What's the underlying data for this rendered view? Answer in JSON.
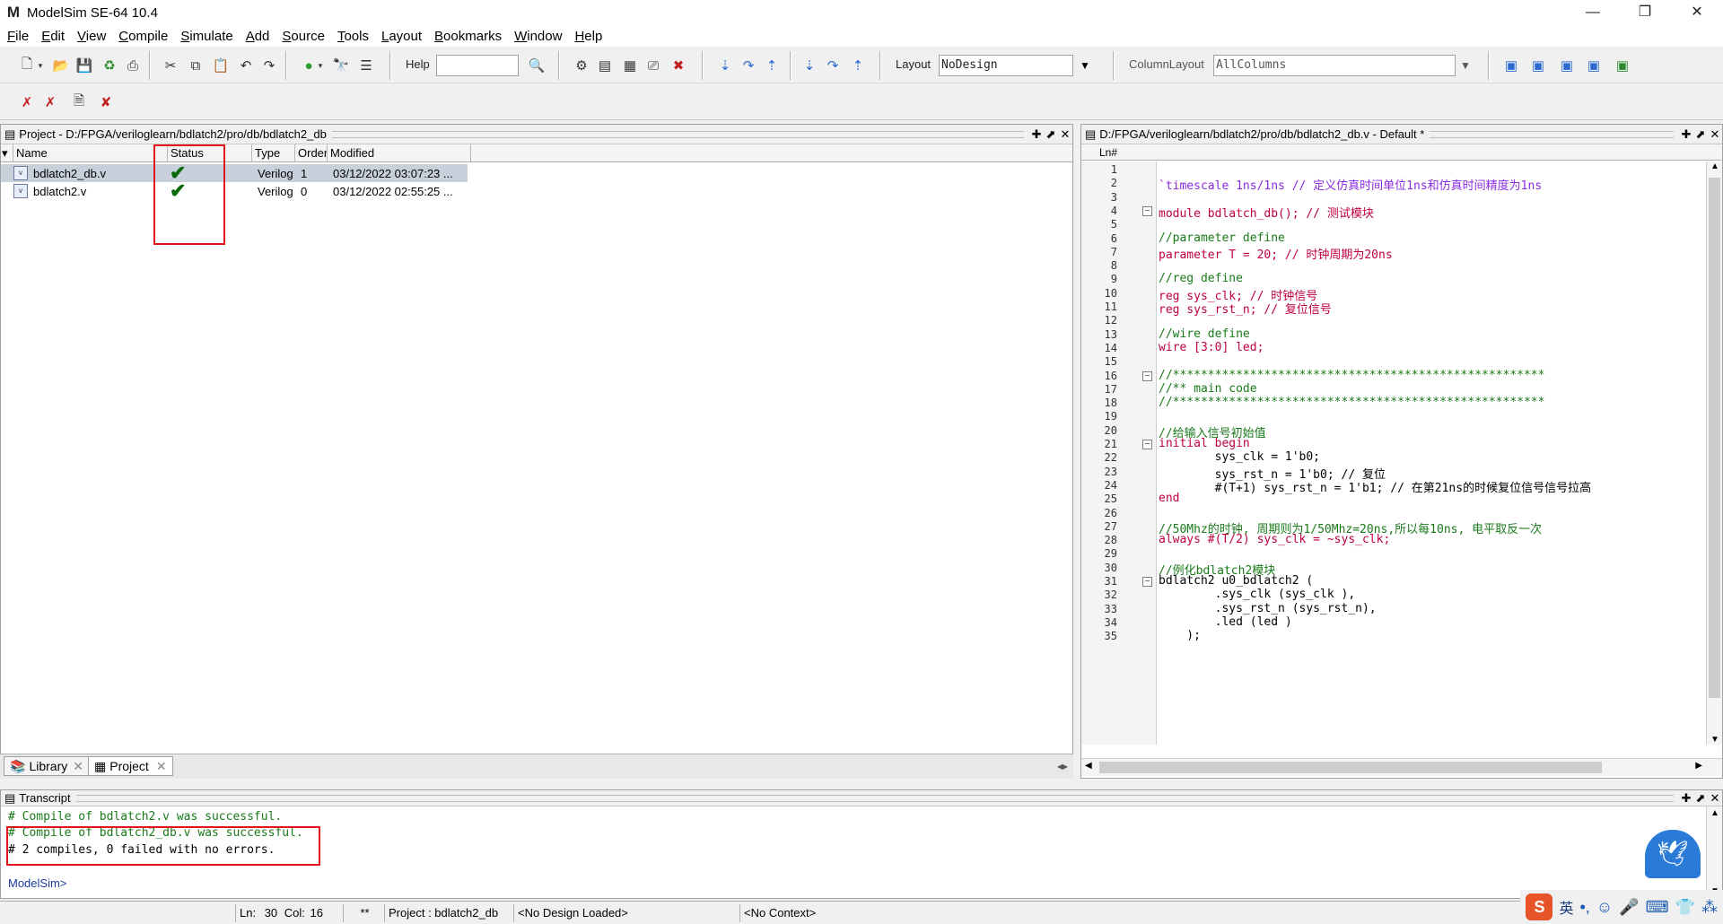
{
  "window": {
    "title": "ModelSim SE-64 10.4",
    "logo": "M",
    "minimize": "—",
    "maximize": "❐",
    "close": "✕"
  },
  "menu": [
    "File",
    "Edit",
    "View",
    "Compile",
    "Simulate",
    "Add",
    "Source",
    "Tools",
    "Layout",
    "Bookmarks",
    "Window",
    "Help"
  ],
  "toolbar": {
    "help_label": "Help",
    "help_value": "",
    "layout_label": "Layout",
    "layout_value": "NoDesign",
    "column_layout_label": "ColumnLayout",
    "column_layout_value": "AllColumns"
  },
  "project": {
    "title": "Project - D:/FPGA/veriloglearn/bdlatch2/pro/db/bdlatch2_db",
    "columns": [
      "Name",
      "Status",
      "Type",
      "Order",
      "Modified"
    ],
    "rows": [
      {
        "name": "bdlatch2_db.v",
        "status": "✔",
        "type": "Verilog",
        "order": "1",
        "modified": "03/12/2022 03:07:23 ..."
      },
      {
        "name": "bdlatch2.v",
        "status": "✔",
        "type": "Verilog",
        "order": "0",
        "modified": "03/12/2022 02:55:25 ..."
      }
    ],
    "tabs": [
      "Library",
      "Project"
    ]
  },
  "editor": {
    "title": "D:/FPGA/veriloglearn/bdlatch2/pro/db/bdlatch2_db.v - Default *",
    "ln_header": "Ln#",
    "lines": [
      "",
      "`timescale 1ns/1ns // 定义仿真时间单位1ns和仿真时间精度为1ns",
      "",
      "module bdlatch_db(); // 测试模块",
      "",
      "//parameter define",
      "parameter T = 20; // 时钟周期为20ns",
      "",
      "//reg define",
      "reg sys_clk; // 时钟信号",
      "reg sys_rst_n; // 复位信号",
      "",
      "//wire define",
      "wire [3:0] led;",
      "",
      "//*****************************************************",
      "//** main code",
      "//*****************************************************",
      "",
      "//给输入信号初始值",
      "initial begin",
      "        sys_clk = 1'b0;",
      "        sys_rst_n = 1'b0; // 复位",
      "        #(T+1) sys_rst_n = 1'b1; // 在第21ns的时候复位信号信号拉高",
      "end",
      "",
      "//50Mhz的时钟, 周期则为1/50Mhz=20ns,所以每10ns, 电平取反一次",
      "always #(T/2) sys_clk = ~sys_clk;",
      "",
      "//例化bdlatch2模块",
      "bdlatch2 u0_bdlatch2 (",
      "        .sys_clk (sys_clk ),",
      "        .sys_rst_n (sys_rst_n),",
      "        .led (led )",
      "    );"
    ]
  },
  "transcript": {
    "title": "Transcript",
    "lines": [
      "# Compile of bdlatch2.v was successful.",
      "# Compile of bdlatch2_db.v was successful.",
      "# 2 compiles, 0 failed with no errors."
    ],
    "prompt": "ModelSim>"
  },
  "status": {
    "ln_label": "Ln:",
    "ln": "30",
    "col_label": "Col:",
    "col": "16",
    "modified_flag": "**",
    "project": "Project : bdlatch2_db",
    "design": "<No Design Loaded>",
    "context": "<No Context>"
  },
  "tray": {
    "ime": "英"
  },
  "colors": {
    "keyword": "#c0003c",
    "comment": "#1a7a1a",
    "success": "#1a7a1a",
    "highlight_box": "#e0141c"
  }
}
